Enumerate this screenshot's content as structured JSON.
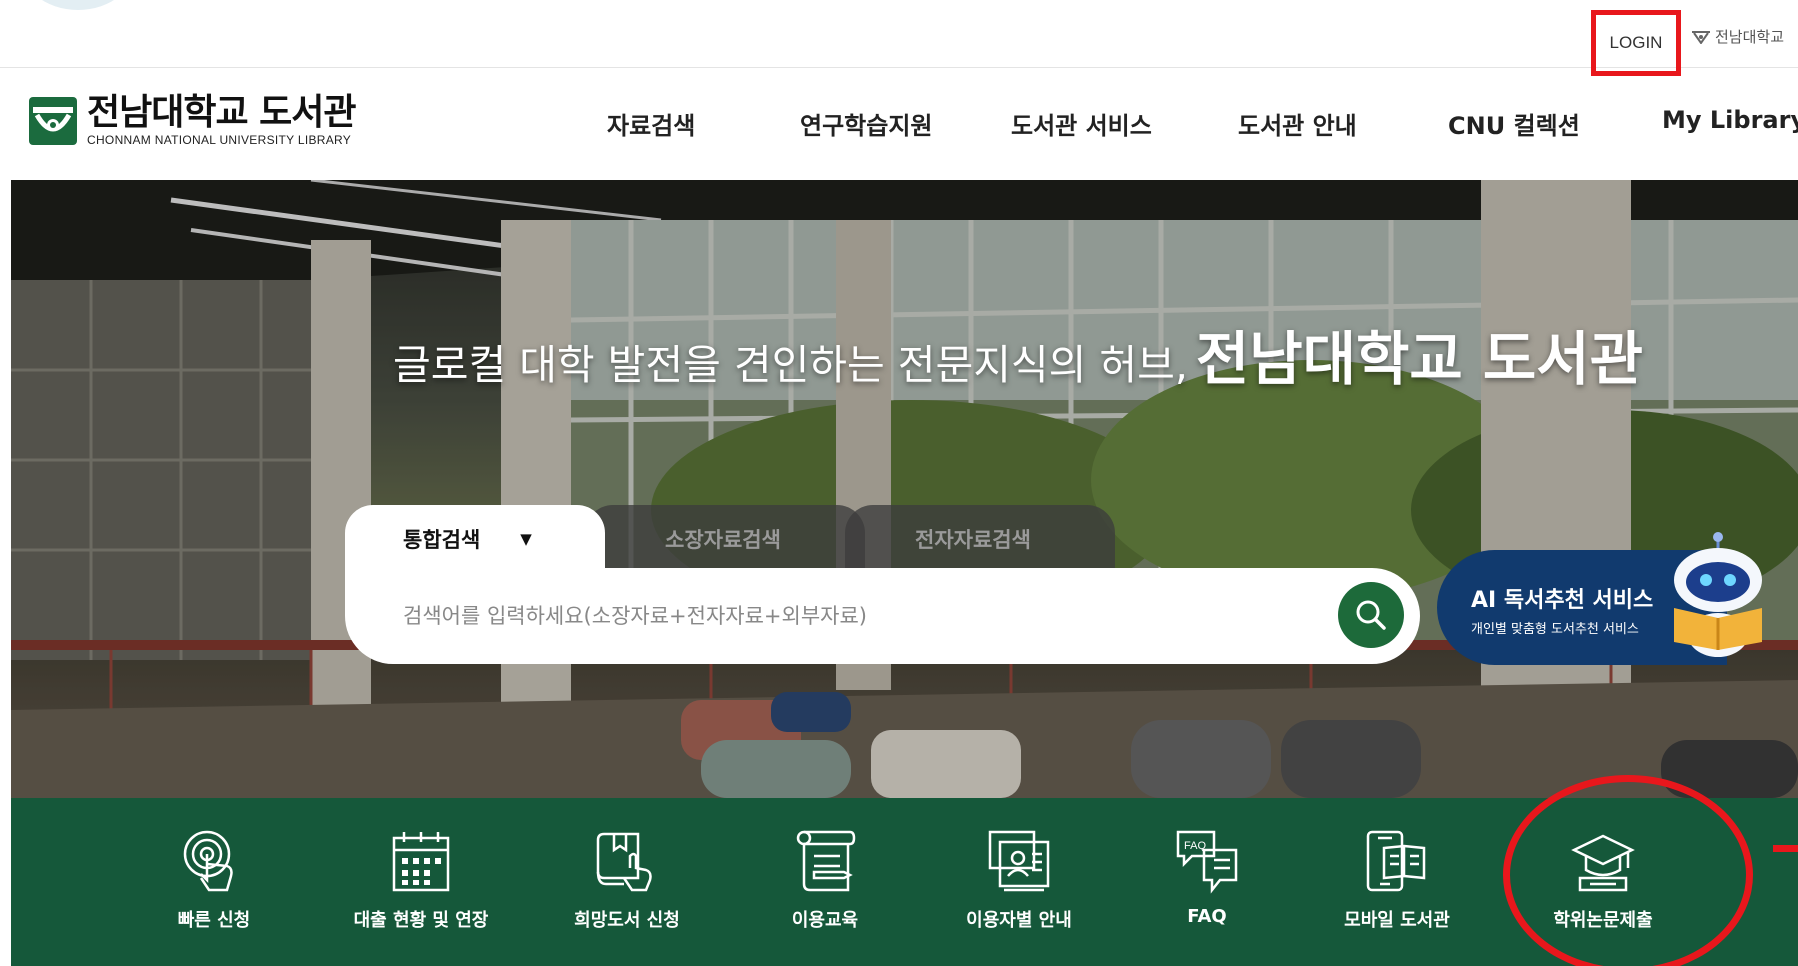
{
  "util": {
    "login_label": "LOGIN",
    "univ_link_label": "전남대학교"
  },
  "logo": {
    "name_ko": "전남대학교 도서관",
    "name_en": "CHONNAM NATIONAL UNIVERSITY LIBRARY"
  },
  "nav": {
    "items": [
      {
        "label": "자료검색"
      },
      {
        "label": "연구학습지원"
      },
      {
        "label": "도서관 서비스"
      },
      {
        "label": "도서관 안내"
      },
      {
        "label": "CNU 컬렉션"
      },
      {
        "label": "My Library"
      }
    ]
  },
  "hero": {
    "slogan": "글로컬 대학 발전을 견인하는 전문지식의 허브,",
    "slogan_emphasis": "전남대학교 도서관"
  },
  "search": {
    "tabs": [
      {
        "label": "통합검색",
        "active": true
      },
      {
        "label": "소장자료검색",
        "active": false
      },
      {
        "label": "전자자료검색",
        "active": false
      }
    ],
    "placeholder": "검색어를 입력하세요(소장자료+전자자료+외부자료)"
  },
  "ai_banner": {
    "title": "AI 독서추천 서비스",
    "subtitle": "개인별 맞춤형 도서추천 서비스"
  },
  "quick_menu": [
    {
      "label": "빠른 신청",
      "icon": "touch-icon"
    },
    {
      "label": "대출 현황 및 연장",
      "icon": "calendar-icon"
    },
    {
      "label": "희망도서 신청",
      "icon": "book-request-icon"
    },
    {
      "label": "이용교육",
      "icon": "scroll-icon"
    },
    {
      "label": "이용자별 안내",
      "icon": "user-guide-icon"
    },
    {
      "label": "FAQ",
      "icon": "faq-icon"
    },
    {
      "label": "모바일 도서관",
      "icon": "mobile-library-icon"
    },
    {
      "label": "학위논문제출",
      "icon": "graduation-cap-icon"
    }
  ],
  "colors": {
    "brand_green": "#15583a",
    "search_button": "#1d6a3a",
    "ai_banner": "#113a6e",
    "highlight_red": "#e8171c"
  }
}
